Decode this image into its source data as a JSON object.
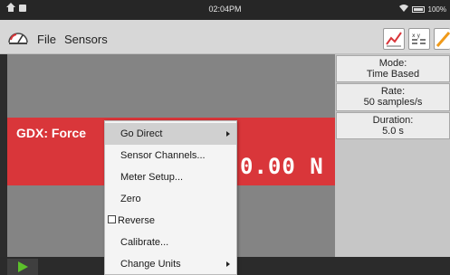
{
  "status_bar": {
    "time": "02:04PM",
    "battery": "100%"
  },
  "menubar": {
    "file_label": "File",
    "sensors_label": "Sensors"
  },
  "toolbar": {
    "graph_icon": "graph-icon",
    "table_icon": "table-icon",
    "meter_icon": "meter-icon"
  },
  "meter": {
    "label": "GDX: Force",
    "value": "0.00 N",
    "color": "#d9363a"
  },
  "collection": {
    "mode_label": "Mode:",
    "mode_value": "Time Based",
    "rate_label": "Rate:",
    "rate_value": "50 samples/s",
    "duration_label": "Duration:",
    "duration_value": "5.0 s"
  },
  "context_menu": {
    "items": [
      {
        "label": "Go Direct",
        "submenu": true,
        "highlighted": true
      },
      {
        "label": "Sensor Channels..."
      },
      {
        "label": "Meter Setup..."
      },
      {
        "label": "Zero"
      },
      {
        "label": "Reverse",
        "checkbox": true,
        "checked": false
      },
      {
        "label": "Calibrate..."
      },
      {
        "label": "Change Units",
        "submenu": true
      }
    ]
  },
  "controls": {
    "play_icon": "play-icon",
    "play_color": "#5cc12b"
  }
}
